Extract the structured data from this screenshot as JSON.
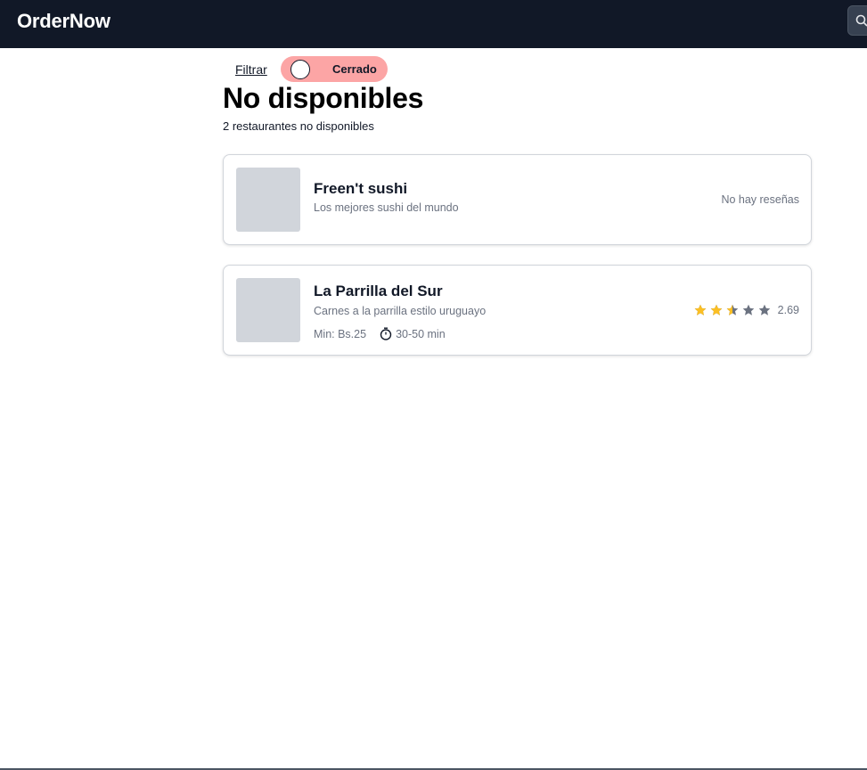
{
  "nav": {
    "brand": "OrderNow"
  },
  "filters": {
    "filter_label": "Filtrar",
    "status_toggle": {
      "label": "Cerrado",
      "state": "off"
    }
  },
  "main": {
    "title": "No disponibles",
    "count_text": "2 restaurantes no disponibles"
  },
  "restaurants": [
    {
      "name": "Freen't sushi",
      "description": "Los mejores sushi del mundo",
      "reviews_text": "No hay reseñas"
    },
    {
      "name": "La Parrilla del Sur",
      "description": "Carnes a la parrilla estilo uruguayo",
      "min_order": "Min: Bs.25",
      "delivery_time": "30-50 min",
      "rating": {
        "value": "2.69",
        "stars": 2.69,
        "max": 5
      }
    }
  ],
  "colors": {
    "navbar_bg": "#111827",
    "toggle_bg": "#fca5a5",
    "star_filled": "#fbbf24",
    "star_empty": "#6b7280",
    "placeholder_img": "#d1d5db"
  },
  "icons": {
    "search": "search-icon",
    "timer": "stopwatch-icon",
    "star": "star-icon"
  }
}
